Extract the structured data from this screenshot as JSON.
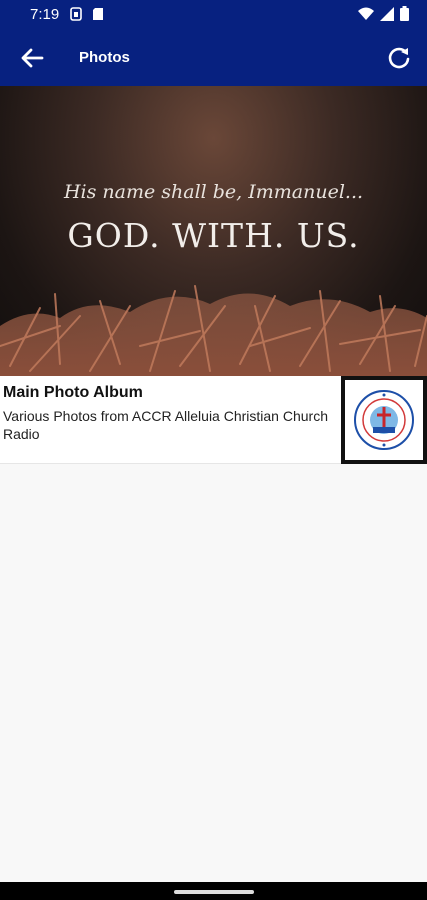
{
  "status_bar": {
    "time": "7:19"
  },
  "app_bar": {
    "title": "Photos"
  },
  "banner": {
    "subtitle": "His name shall be, Immanuel...",
    "headline": "GOD. WITH. US."
  },
  "album": {
    "title": "Main Photo Album",
    "description": "Various Photos from ACCR Alleluia Christian Church Radio"
  },
  "colors": {
    "app_bar": "#072180",
    "background": "#f8f8f8"
  }
}
